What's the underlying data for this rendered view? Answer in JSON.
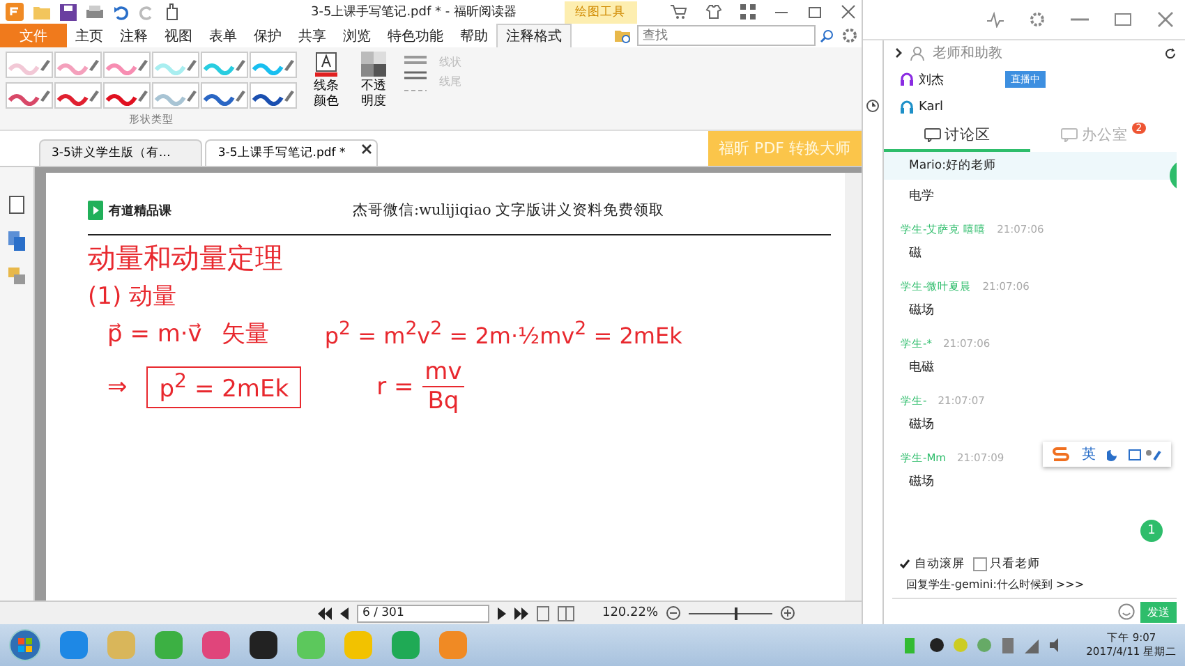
{
  "title_bar": {
    "title": "3-5上课手写笔记.pdf * - 福昕阅读器",
    "context_tab": "绘图工具"
  },
  "ribbon_tabs": [
    {
      "label": "文件",
      "kind": "file",
      "selected": false
    },
    {
      "label": "主页",
      "kind": "tab",
      "selected": false
    },
    {
      "label": "注释",
      "kind": "tab",
      "selected": false
    },
    {
      "label": "视图",
      "kind": "tab",
      "selected": false
    },
    {
      "label": "表单",
      "kind": "tab",
      "selected": false
    },
    {
      "label": "保护",
      "kind": "tab",
      "selected": false
    },
    {
      "label": "共享",
      "kind": "tab",
      "selected": false
    },
    {
      "label": "浏览",
      "kind": "tab",
      "selected": false
    },
    {
      "label": "特色功能",
      "kind": "tab",
      "selected": false
    },
    {
      "label": "帮助",
      "kind": "tab",
      "selected": false
    },
    {
      "label": "注释格式",
      "kind": "tab",
      "selected": true
    }
  ],
  "search": {
    "placeholder": "查找"
  },
  "ribbon": {
    "pen_styles": [
      {
        "color": "#f2c8d6"
      },
      {
        "color": "#f4a0bc"
      },
      {
        "color": "#f78db2"
      },
      {
        "color": "#a8eef0"
      },
      {
        "color": "#28cde0"
      },
      {
        "color": "#18bff0"
      },
      {
        "color": "#d84868"
      },
      {
        "color": "#e02030"
      },
      {
        "color": "#e01020"
      },
      {
        "color": "#a8c4d4"
      },
      {
        "color": "#2a66c4"
      },
      {
        "color": "#1a4fb0"
      }
    ],
    "group_label": "形状类型",
    "line_color": "线条颜色",
    "opacity": "不透明度",
    "disabled_items": [
      {
        "label": "线状",
        "disabled": true
      },
      {
        "label": "线尾",
        "disabled": true
      }
    ]
  },
  "doc_tabs": [
    {
      "label": "3-5讲义学生版（有…",
      "selected": false
    },
    {
      "label": "3-5上课手写笔记.pdf *",
      "selected": true
    }
  ],
  "banner": "福昕 PDF 转换大师",
  "document": {
    "logo": "有道精品课",
    "header": "杰哥微信:wulijiqiao  文字版讲义资料免费领取",
    "notes": {
      "title": "动量和动量定理",
      "subheading": "(1) 动量",
      "vector_formula": "p⃗ = m·v⃗",
      "vector_label": "矢量",
      "energy_formula": "p$^{2}$ = m$^{2}$v$^{2}$ = 2m·½mv$^{2}$ = 2mEk",
      "implies": "⇒",
      "boxed_formula": "p$^{2}$ = 2mEk",
      "radius": {
        "lhs": "r =",
        "numerator": "mv",
        "denominator": "Bq"
      }
    }
  },
  "status_bar": {
    "page": "6 / 301",
    "zoom": "120.22%",
    "zoom_slider": {
      "level": 0.55
    }
  },
  "panel": {
    "section_title": "老师和助教",
    "teachers": [
      {
        "name": "刘杰",
        "badge": "直播中",
        "color": "#8a2be2"
      },
      {
        "name": "Karl",
        "color": "#1e90c8"
      }
    ],
    "tabs": [
      {
        "label": "讨论区",
        "selected": true
      },
      {
        "label": "办公室",
        "selected": false,
        "badge": "2"
      }
    ],
    "pinned": "Mario:好的老师",
    "first_message": "电学",
    "messages": [
      {
        "sender": "学生-艾萨克 嘻嘻",
        "time": "21:07:06",
        "text": "磁"
      },
      {
        "sender": "学生-微叶夏晨",
        "time": "21:07:06",
        "text": "磁场"
      },
      {
        "sender": "学生-*",
        "time": "21:07:06",
        "text": "电磁"
      },
      {
        "sender": "学生-",
        "time": "21:07:07",
        "text": "磁场"
      },
      {
        "sender": "学生-Mm",
        "time": "21:07:09",
        "text": "磁场"
      }
    ],
    "ime_label": "英",
    "unread": "1",
    "options": [
      {
        "label": "自动滚屏",
        "checked": true
      },
      {
        "label": "只看老师",
        "checked": false
      }
    ],
    "reply": "回复学生-gemini:什么时候到 >>>",
    "send": "发送"
  },
  "taskbar": {
    "time": "下午 9:07",
    "date": "2017/4/11 星期二"
  }
}
